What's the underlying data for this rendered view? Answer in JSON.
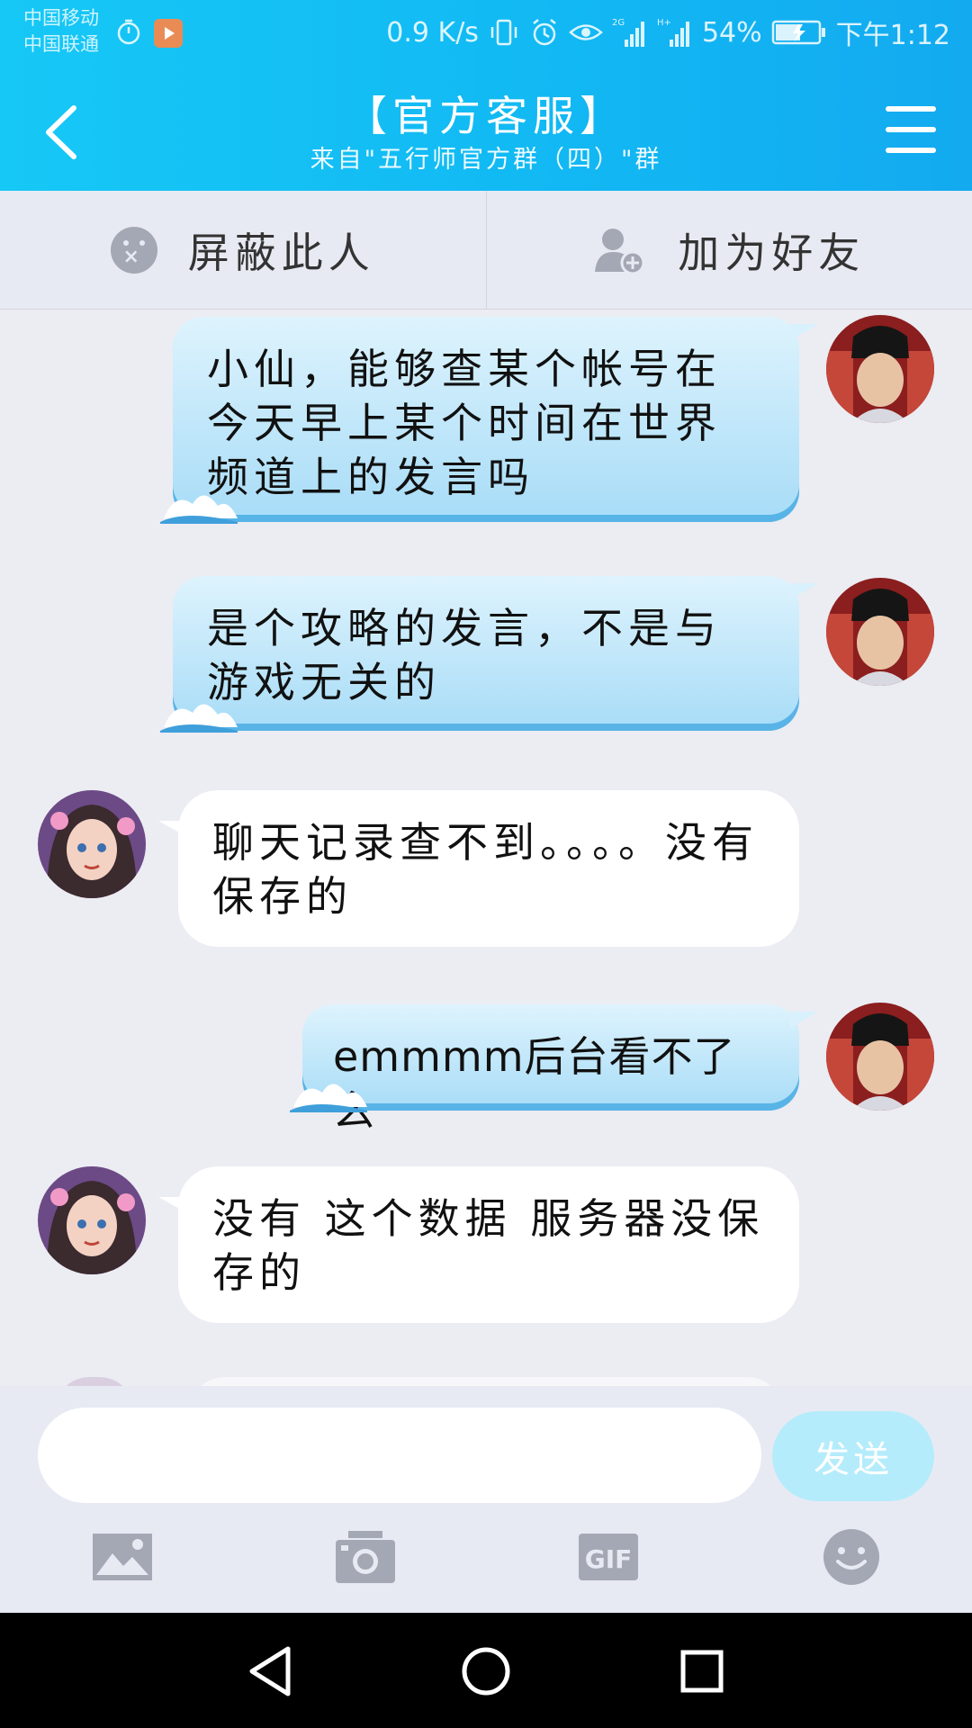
{
  "status_bar": {
    "carrier_1": "中国移动",
    "carrier_2": "中国联通",
    "network_speed": "0.9 K/s",
    "signal_1_tag": "2G",
    "signal_2_tag": "H+",
    "battery": "54%",
    "time": "下午1:12"
  },
  "header": {
    "title": "【官方客服】",
    "subtitle": "来自\"五行师官方群（四）\"群"
  },
  "actions": {
    "block_label": "屏蔽此人",
    "add_friend_label": "加为好友"
  },
  "messages": [
    {
      "side": "out",
      "text": "小仙，能够查某个帐号在今天早上某个时间在世界频道上的发言吗"
    },
    {
      "side": "out",
      "text": "是个攻略的发言，不是与游戏无关的"
    },
    {
      "side": "in",
      "text": "聊天记录查不到。。。。没有保存的"
    },
    {
      "side": "out",
      "text": "emmmm后台看不了么"
    },
    {
      "side": "in",
      "text": "没有 这个数据 服务器没保存的"
    }
  ],
  "composer": {
    "input_value": "",
    "input_placeholder": "",
    "send_label": "发送",
    "tool_icons": [
      "image-icon",
      "camera-icon",
      "gif-icon",
      "emoji-icon"
    ],
    "gif_label": "GIF"
  },
  "colors": {
    "header_start": "#16c8f6",
    "header_end": "#13aaf0",
    "out_bubble": "#a7dcf7",
    "in_bubble": "#ffffff",
    "send_button": "#b5ecfb",
    "icon_gray": "#a4a8b4"
  }
}
